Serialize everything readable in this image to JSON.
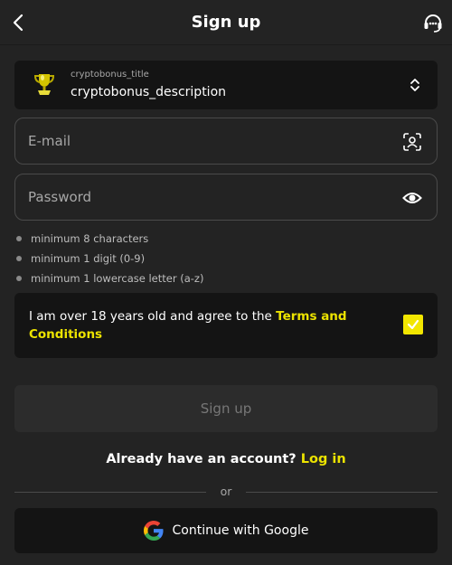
{
  "header": {
    "title": "Sign up",
    "back_icon": "chevron-left-icon",
    "support_icon": "headset-icon"
  },
  "bonus": {
    "title": "cryptobonus_title",
    "description": "cryptobonus_description",
    "icon": "trophy-icon",
    "chevron_icon": "chevron-up-down-icon"
  },
  "form": {
    "email_placeholder": "E-mail",
    "email_value": "",
    "email_icon": "contact-scan-icon",
    "password_placeholder": "Password",
    "password_value": "",
    "password_icon": "eye-icon"
  },
  "password_rules": [
    "minimum 8 characters",
    "minimum 1 digit (0-9)",
    "minimum 1 lowercase letter (a-z)"
  ],
  "terms": {
    "text": "I am over 18 years old and agree to the ",
    "link": "Terms and Conditions",
    "checked": true
  },
  "signup_button": "Sign up",
  "login": {
    "prompt": "Already have an account? ",
    "link": "Log in"
  },
  "divider_text": "or",
  "google_button": "Continue with Google",
  "colors": {
    "background": "#232323",
    "accent": "#ece300",
    "card": "#141414"
  }
}
